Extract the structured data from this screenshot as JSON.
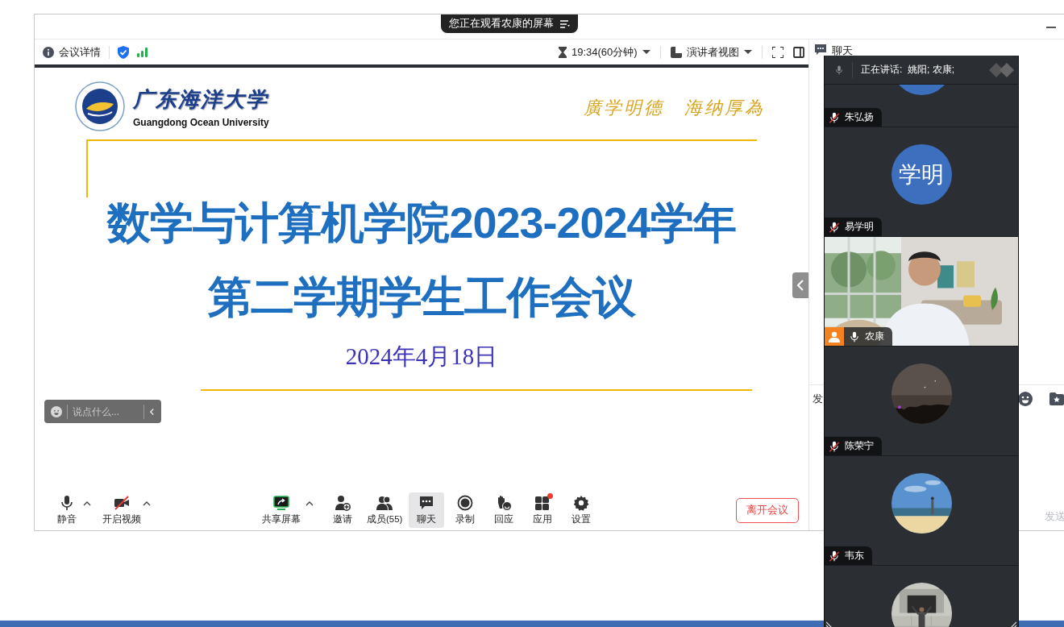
{
  "banner": {
    "text": "您正在观看农康的屏幕"
  },
  "toolbar": {
    "meeting_info": "会议详情",
    "timer": "19:34(60分钟)",
    "view_mode": "演讲者视图"
  },
  "chat": {
    "title": "聊天",
    "fragment": "发",
    "send": "发送"
  },
  "slide": {
    "university_cn": "广东海洋大学",
    "university_en": "Guangdong Ocean University",
    "motto": "廣学明德　海纳厚為",
    "title_lines": [
      "数学与计算机学院2023-2024学年",
      "第二学期学生工作会议"
    ],
    "date": "2024年4月18日"
  },
  "reaction_bar": {
    "placeholder": "说点什么..."
  },
  "controls": [
    {
      "label": "静音",
      "kind": "mic",
      "caret": true,
      "selected": false,
      "notification": false
    },
    {
      "label": "开启视频",
      "kind": "camera-off",
      "caret": true,
      "selected": false,
      "notification": false
    },
    {
      "label": "共享屏幕",
      "kind": "share",
      "caret": true,
      "selected": false,
      "notification": false
    },
    {
      "label": "邀请",
      "kind": "invite",
      "caret": false,
      "selected": false,
      "notification": false
    },
    {
      "label": "成员(55)",
      "kind": "members",
      "caret": false,
      "selected": false,
      "notification": false
    },
    {
      "label": "聊天",
      "kind": "chat",
      "caret": false,
      "selected": true,
      "notification": false
    },
    {
      "label": "录制",
      "kind": "record",
      "caret": false,
      "selected": false,
      "notification": false
    },
    {
      "label": "回应",
      "kind": "react",
      "caret": false,
      "selected": false,
      "notification": false
    },
    {
      "label": "应用",
      "kind": "apps",
      "caret": false,
      "selected": false,
      "notification": true
    },
    {
      "label": "设置",
      "kind": "settings",
      "caret": false,
      "selected": false,
      "notification": false
    }
  ],
  "leave_button": "离开会议",
  "speaker_panel": {
    "speaking": "正在讲话:  姚阳; 农康;",
    "participants": [
      {
        "name": "朱弘扬",
        "muted": true,
        "kind": "initials",
        "color": "#3d6fbf",
        "presenter": false
      },
      {
        "name": "易学明",
        "muted": true,
        "kind": "initials",
        "color": "#3d6fbf",
        "initials": "学明",
        "presenter": false
      },
      {
        "name": "农康",
        "muted": false,
        "kind": "video",
        "presenter": true
      },
      {
        "name": "陈荣宁",
        "muted": true,
        "kind": "picture",
        "presenter": false
      },
      {
        "name": "韦东",
        "muted": true,
        "kind": "picture",
        "presenter": false
      },
      {
        "kind": "picture"
      }
    ]
  }
}
